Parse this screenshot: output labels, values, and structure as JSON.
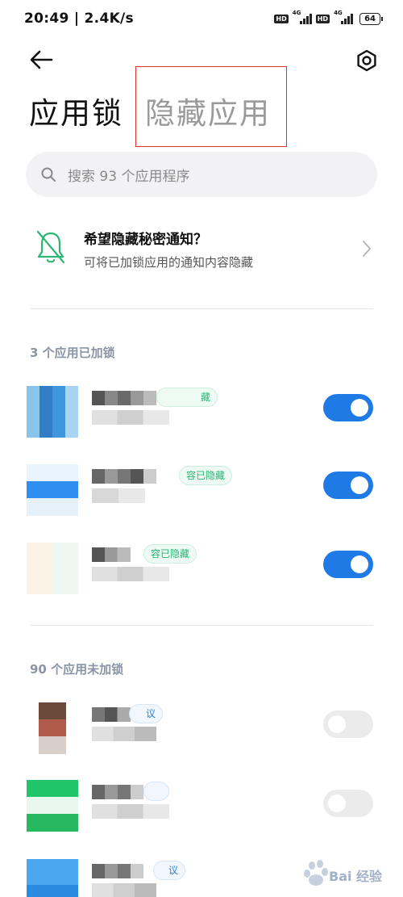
{
  "status_bar": {
    "time_speed": "20:49 | 2.4K/s",
    "hd1": "HD",
    "net1": "4G",
    "hd2": "HD",
    "net2": "4G",
    "battery": "64"
  },
  "header": {
    "tab_locked": "应用锁",
    "tab_hidden": "隐藏应用"
  },
  "search": {
    "placeholder": "搜索 93 个应用程序"
  },
  "notice": {
    "title": "希望隐藏秘密通知？",
    "subtitle": "可将已加锁应用的通知内容隐藏"
  },
  "locked_section": {
    "header": "3 个应用已加锁",
    "apps": [
      {
        "badge": "藏",
        "badge_style": "green",
        "enabled": true
      },
      {
        "badge": "容已隐藏",
        "badge_style": "green",
        "enabled": true
      },
      {
        "badge": "容已隐藏",
        "badge_style": "green",
        "enabled": true
      }
    ]
  },
  "unlocked_section": {
    "header": "90 个应用未加锁",
    "apps": [
      {
        "badge": "议",
        "badge_style": "blue",
        "enabled": false
      },
      {
        "badge": "",
        "badge_style": "blue",
        "enabled": false
      },
      {
        "badge": "议",
        "badge_style": "blue",
        "enabled": false
      }
    ]
  },
  "watermark": {
    "text": "Bai 经验"
  },
  "colors": {
    "accent": "#1f7ae6",
    "highlight_box": "#d9312b",
    "notice_icon": "#2bb673"
  },
  "icons": [
    "back-arrow-icon",
    "gear-icon",
    "search-icon",
    "bell-off-icon",
    "chevron-right-icon"
  ]
}
